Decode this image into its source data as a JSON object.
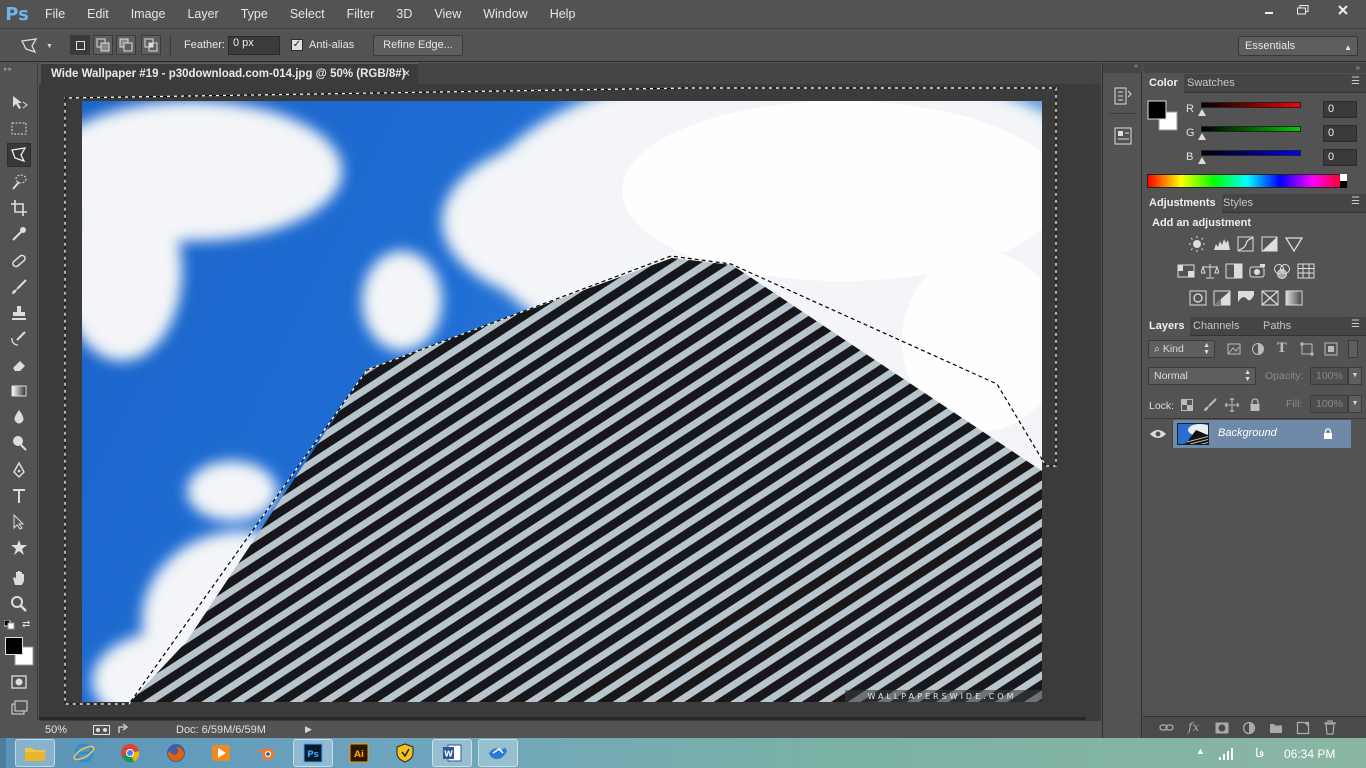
{
  "app": {
    "logo_text": "Ps",
    "menu": [
      "File",
      "Edit",
      "Image",
      "Layer",
      "Type",
      "Select",
      "Filter",
      "3D",
      "View",
      "Window",
      "Help"
    ]
  },
  "options_bar": {
    "feather_label": "Feather:",
    "feather_value": "0 px",
    "anti_alias_label": "Anti-alias",
    "anti_alias_checked": true,
    "refine_edge_label": "Refine Edge...",
    "workspace_value": "Essentials"
  },
  "document": {
    "tab_title": "Wide Wallpaper #19 - p30download.com-014.jpg @ 50% (RGB/8#)",
    "close_glyph": "×",
    "watermark": "WALLPAPERSWIDE.COM"
  },
  "status_bar": {
    "zoom": "50%",
    "doc_size": "Doc: 6/59M/6/59M"
  },
  "color_panel": {
    "tabs": [
      "Color",
      "Swatches"
    ],
    "active_tab": "Color",
    "channels": [
      {
        "label": "R",
        "value": "0",
        "color": "#ff0000"
      },
      {
        "label": "G",
        "value": "0",
        "color": "#00cc00"
      },
      {
        "label": "B",
        "value": "0",
        "color": "#0000ff"
      }
    ],
    "foreground": "#000000",
    "background": "#ffffff"
  },
  "adjustments_panel": {
    "tabs": [
      "Adjustments",
      "Styles"
    ],
    "active_tab": "Adjustments",
    "heading": "Add an adjustment",
    "icons_row1": [
      "brightness-contrast-icon",
      "levels-icon",
      "curves-icon",
      "exposure-icon",
      "vibrance-icon"
    ],
    "icons_row2": [
      "hue-saturation-icon",
      "color-balance-icon",
      "black-white-icon",
      "photo-filter-icon",
      "channel-mixer-icon",
      "color-lookup-icon"
    ],
    "icons_row3": [
      "invert-icon",
      "posterize-icon",
      "threshold-icon",
      "selective-color-icon",
      "gradient-map-icon"
    ]
  },
  "layers_panel": {
    "tabs": [
      "Layers",
      "Channels",
      "Paths"
    ],
    "active_tab": "Layers",
    "filter_kind": "Kind",
    "blend_mode": "Normal",
    "opacity_label": "Opacity:",
    "opacity_value": "100%",
    "lock_label": "Lock:",
    "fill_label": "Fill:",
    "fill_value": "100%",
    "layers": [
      {
        "name": "Background",
        "visible": true,
        "locked": true
      }
    ]
  },
  "taskbar": {
    "language": "فا",
    "time": "06:34 PM",
    "apps": [
      "file-explorer-icon",
      "internet-explorer-icon",
      "chrome-icon",
      "firefox-icon",
      "media-player-icon",
      "blender-icon",
      "photoshop-icon",
      "illustrator-icon",
      "vpn-icon",
      "word-icon",
      "app-icon"
    ],
    "active_app": "photoshop-icon"
  }
}
